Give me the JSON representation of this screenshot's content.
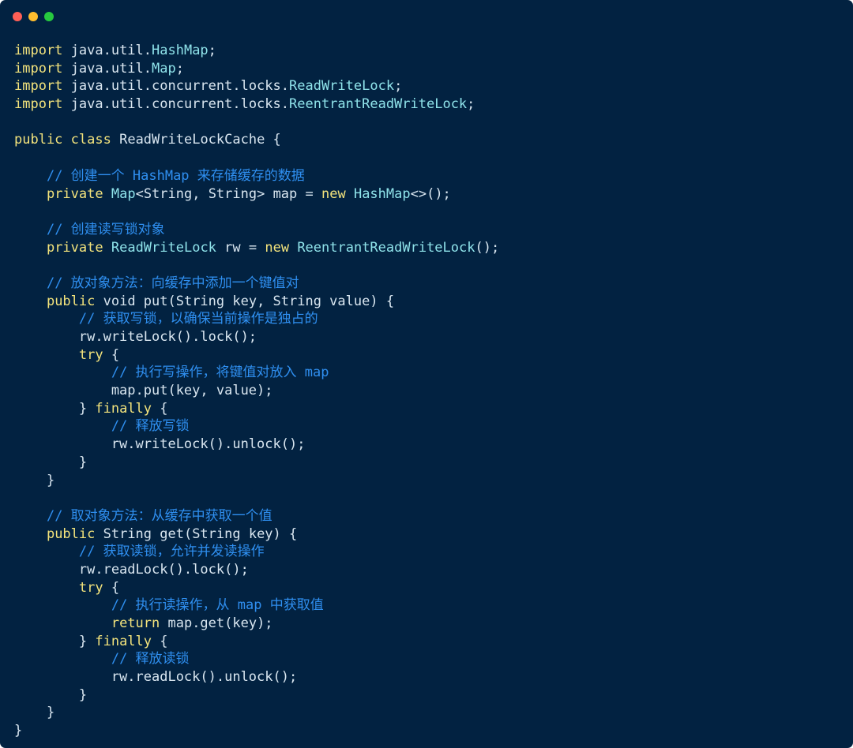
{
  "window": {
    "colors": {
      "background": "#022241",
      "close": "#ff5f56",
      "minimize": "#ffbd2e",
      "zoom": "#27c93f",
      "keyword": "#f3e37c",
      "type": "#8fe3ea",
      "comment": "#2f8ff0",
      "plain": "#d9e6f0"
    }
  },
  "code": {
    "language": "java",
    "lines": [
      [
        {
          "t": "kw",
          "v": "import"
        },
        {
          "t": "plain",
          "v": " java.util."
        },
        {
          "t": "type",
          "v": "HashMap"
        },
        {
          "t": "plain",
          "v": ";"
        }
      ],
      [
        {
          "t": "kw",
          "v": "import"
        },
        {
          "t": "plain",
          "v": " java.util."
        },
        {
          "t": "type",
          "v": "Map"
        },
        {
          "t": "plain",
          "v": ";"
        }
      ],
      [
        {
          "t": "kw",
          "v": "import"
        },
        {
          "t": "plain",
          "v": " java.util.concurrent.locks."
        },
        {
          "t": "type",
          "v": "ReadWriteLock"
        },
        {
          "t": "plain",
          "v": ";"
        }
      ],
      [
        {
          "t": "kw",
          "v": "import"
        },
        {
          "t": "plain",
          "v": " java.util.concurrent.locks."
        },
        {
          "t": "type",
          "v": "ReentrantReadWriteLock"
        },
        {
          "t": "plain",
          "v": ";"
        }
      ],
      [],
      [
        {
          "t": "kw",
          "v": "public"
        },
        {
          "t": "plain",
          "v": " "
        },
        {
          "t": "kw",
          "v": "class"
        },
        {
          "t": "plain",
          "v": " ReadWriteLockCache {"
        }
      ],
      [],
      [
        {
          "t": "plain",
          "v": "    "
        },
        {
          "t": "comment",
          "v": "// 创建一个 HashMap 来存储缓存的数据"
        }
      ],
      [
        {
          "t": "plain",
          "v": "    "
        },
        {
          "t": "kw",
          "v": "private"
        },
        {
          "t": "plain",
          "v": " "
        },
        {
          "t": "type",
          "v": "Map"
        },
        {
          "t": "plain",
          "v": "<String, String> map = "
        },
        {
          "t": "kw",
          "v": "new"
        },
        {
          "t": "plain",
          "v": " "
        },
        {
          "t": "type",
          "v": "HashMap"
        },
        {
          "t": "plain",
          "v": "<>();"
        }
      ],
      [],
      [
        {
          "t": "plain",
          "v": "    "
        },
        {
          "t": "comment",
          "v": "// 创建读写锁对象"
        }
      ],
      [
        {
          "t": "plain",
          "v": "    "
        },
        {
          "t": "kw",
          "v": "private"
        },
        {
          "t": "plain",
          "v": " "
        },
        {
          "t": "type",
          "v": "ReadWriteLock"
        },
        {
          "t": "plain",
          "v": " rw = "
        },
        {
          "t": "kw",
          "v": "new"
        },
        {
          "t": "plain",
          "v": " "
        },
        {
          "t": "type",
          "v": "ReentrantReadWriteLock"
        },
        {
          "t": "plain",
          "v": "();"
        }
      ],
      [],
      [
        {
          "t": "plain",
          "v": "    "
        },
        {
          "t": "comment",
          "v": "// 放对象方法：向缓存中添加一个键值对"
        }
      ],
      [
        {
          "t": "plain",
          "v": "    "
        },
        {
          "t": "kw",
          "v": "public"
        },
        {
          "t": "plain",
          "v": " void put(String key, String value) {"
        }
      ],
      [
        {
          "t": "plain",
          "v": "        "
        },
        {
          "t": "comment",
          "v": "// 获取写锁，以确保当前操作是独占的"
        }
      ],
      [
        {
          "t": "plain",
          "v": "        rw.writeLock().lock();"
        }
      ],
      [
        {
          "t": "plain",
          "v": "        "
        },
        {
          "t": "kw",
          "v": "try"
        },
        {
          "t": "plain",
          "v": " {"
        }
      ],
      [
        {
          "t": "plain",
          "v": "            "
        },
        {
          "t": "comment",
          "v": "// 执行写操作，将键值对放入 map"
        }
      ],
      [
        {
          "t": "plain",
          "v": "            map.put(key, value);"
        }
      ],
      [
        {
          "t": "plain",
          "v": "        } "
        },
        {
          "t": "kw",
          "v": "finally"
        },
        {
          "t": "plain",
          "v": " {"
        }
      ],
      [
        {
          "t": "plain",
          "v": "            "
        },
        {
          "t": "comment",
          "v": "// 释放写锁"
        }
      ],
      [
        {
          "t": "plain",
          "v": "            rw.writeLock().unlock();"
        }
      ],
      [
        {
          "t": "plain",
          "v": "        }"
        }
      ],
      [
        {
          "t": "plain",
          "v": "    }"
        }
      ],
      [],
      [
        {
          "t": "plain",
          "v": "    "
        },
        {
          "t": "comment",
          "v": "// 取对象方法：从缓存中获取一个值"
        }
      ],
      [
        {
          "t": "plain",
          "v": "    "
        },
        {
          "t": "kw",
          "v": "public"
        },
        {
          "t": "plain",
          "v": " String get(String key) {"
        }
      ],
      [
        {
          "t": "plain",
          "v": "        "
        },
        {
          "t": "comment",
          "v": "// 获取读锁，允许并发读操作"
        }
      ],
      [
        {
          "t": "plain",
          "v": "        rw.readLock().lock();"
        }
      ],
      [
        {
          "t": "plain",
          "v": "        "
        },
        {
          "t": "kw",
          "v": "try"
        },
        {
          "t": "plain",
          "v": " {"
        }
      ],
      [
        {
          "t": "plain",
          "v": "            "
        },
        {
          "t": "comment",
          "v": "// 执行读操作，从 map 中获取值"
        }
      ],
      [
        {
          "t": "plain",
          "v": "            "
        },
        {
          "t": "kw",
          "v": "return"
        },
        {
          "t": "plain",
          "v": " map.get(key);"
        }
      ],
      [
        {
          "t": "plain",
          "v": "        } "
        },
        {
          "t": "kw",
          "v": "finally"
        },
        {
          "t": "plain",
          "v": " {"
        }
      ],
      [
        {
          "t": "plain",
          "v": "            "
        },
        {
          "t": "comment",
          "v": "// 释放读锁"
        }
      ],
      [
        {
          "t": "plain",
          "v": "            rw.readLock().unlock();"
        }
      ],
      [
        {
          "t": "plain",
          "v": "        }"
        }
      ],
      [
        {
          "t": "plain",
          "v": "    }"
        }
      ],
      [
        {
          "t": "plain",
          "v": "}"
        }
      ]
    ]
  }
}
